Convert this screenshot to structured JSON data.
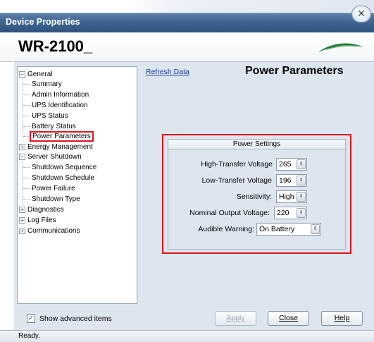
{
  "window": {
    "title": "Device Properties"
  },
  "header": {
    "device_name": "WR-2100_"
  },
  "tree": {
    "items": [
      {
        "label": "General",
        "level": 0,
        "expander": "⊟"
      },
      {
        "label": "Summary",
        "level": 1
      },
      {
        "label": "Admin Information",
        "level": 1
      },
      {
        "label": "UPS Identification",
        "level": 1
      },
      {
        "label": "UPS Status",
        "level": 1
      },
      {
        "label": "Battery Status",
        "level": 1
      },
      {
        "label": "Power Parameters",
        "level": 1,
        "selected": true
      },
      {
        "label": "Energy Management",
        "level": 0,
        "expander": "⊞"
      },
      {
        "label": "Server Shutdown",
        "level": 0,
        "expander": "⊟"
      },
      {
        "label": "Shutdown Sequence",
        "level": 1
      },
      {
        "label": "Shutdown Schedule",
        "level": 1
      },
      {
        "label": "Power Failure",
        "level": 1
      },
      {
        "label": "Shutdown Type",
        "level": 1
      },
      {
        "label": "Diagnostics",
        "level": 0,
        "expander": "⊞"
      },
      {
        "label": "Log Files",
        "level": 0,
        "expander": "⊞"
      },
      {
        "label": "Communications",
        "level": 0,
        "expander": "⊞"
      }
    ]
  },
  "content": {
    "refresh_link": "Refresh Data",
    "heading": "Power Parameters"
  },
  "settings": {
    "title": "Power Settings",
    "fields": {
      "high_transfer": {
        "label": "High-Transfer Voltage",
        "value": "265"
      },
      "low_transfer": {
        "label": "Low-Transfer Voltage",
        "value": "196"
      },
      "sensitivity": {
        "label": "Sensitivity:",
        "value": "High"
      },
      "nominal_output": {
        "label": "Nominal Output Voltage:",
        "value": "220"
      },
      "audible_warning": {
        "label": "Audible Warning:",
        "value": "On Battery"
      }
    }
  },
  "footer": {
    "show_advanced": "Show advanced items",
    "show_advanced_checked": true,
    "apply_label": "Apply",
    "close_label": "Close",
    "help_label": "Help"
  },
  "status": {
    "text": "Ready."
  },
  "colors": {
    "accent": "#3f6591",
    "highlight": "#e0141e",
    "link": "#1a3c8c"
  }
}
